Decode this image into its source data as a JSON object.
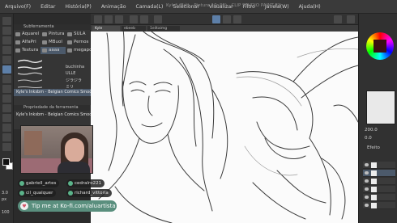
{
  "window": {
    "title": "Kyle* (Bélt - Pintura 10x30) - CLIP STUDIO PAINT EX"
  },
  "menu": {
    "items": [
      "Arquivo(F)",
      "Editar",
      "História(P)",
      "Animação",
      "Camada(L)",
      "Selecionar",
      "Visualizar",
      "Filtro",
      "Janela(W)",
      "Ajuda(H)"
    ]
  },
  "doc_tabs": [
    "Kyle",
    "ebeeb",
    "1eiltaimg"
  ],
  "subtool": {
    "header": "Subferramenta",
    "tabs": [
      {
        "label": "Aquarel",
        "icon": "watercolor-icon"
      },
      {
        "label": "Pintura",
        "icon": "paint-icon"
      },
      {
        "label": "SULA",
        "icon": "sula-icon"
      },
      {
        "label": "AlfaPri",
        "icon": "airbrush-icon"
      },
      {
        "label": "MBuol",
        "icon": "brush-icon"
      },
      {
        "label": "Pernos",
        "icon": "pen-icon"
      },
      {
        "label": "Textura",
        "icon": "texture-icon"
      },
      {
        "label": "aaaa",
        "icon": "brush-icon"
      },
      {
        "label": "megapo",
        "icon": "brush-icon"
      }
    ],
    "brushes": [
      {
        "name": "",
        "stroke": "#e8e8e8"
      },
      {
        "name": "buchinha",
        "stroke": "#d8d8d8"
      },
      {
        "name": "ULLE",
        "stroke": "#c8c8c8"
      },
      {
        "name": "ジラジラ",
        "stroke": "#bfbfbf"
      },
      {
        "name": "ミリ",
        "stroke": "#b8b8b8"
      }
    ],
    "selected": "Kyle's Inksbm - Belgian Comics Smoo"
  },
  "tool_props": {
    "header": "Propriedade da ferramenta",
    "brush": "Kyle's Inksbm - Belgian Comics Smoother"
  },
  "stream_overlay": {
    "chat_users": [
      "gabriell_artes",
      "cedralro221",
      "cil_qualquer",
      "richard_vittoria"
    ],
    "kofi_text": "Tip me at Ko-fi.com/aluartista"
  },
  "left_readouts": {
    "size": "3.0",
    "unit": "px",
    "opacity": "100"
  },
  "right_dock": {
    "zoom": "200.0",
    "rotation": "0.0",
    "effect_label": "Efeito",
    "layers_count": 6
  },
  "colors": {
    "accent": "#5d7fa8",
    "kofi": "#5a8f7e",
    "panel": "#353535",
    "canvas": "#fbfbfb"
  }
}
